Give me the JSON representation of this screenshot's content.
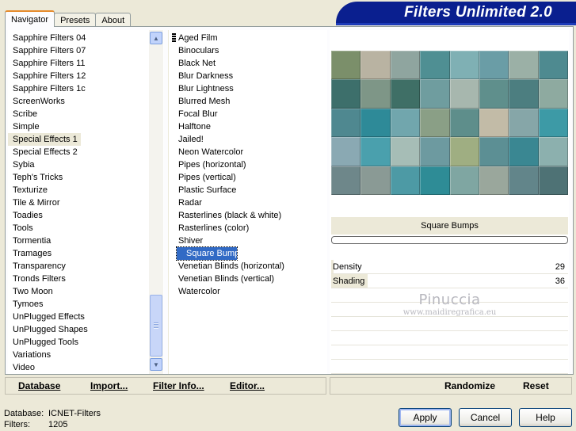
{
  "brand": {
    "title": "Filters Unlimited 2.0"
  },
  "tabs": [
    {
      "label": "Navigator",
      "active": true
    },
    {
      "label": "Presets",
      "active": false
    },
    {
      "label": "About",
      "active": false
    }
  ],
  "categories": [
    "Sapphire Filters 04",
    "Sapphire Filters 07",
    "Sapphire Filters 11",
    "Sapphire Filters 12",
    "Sapphire Filters 1c",
    "ScreenWorks",
    "Scribe",
    "Simple",
    "Special Effects 1",
    "Special Effects 2",
    "Sybia",
    "Teph's Tricks",
    "Texturize",
    "Tile & Mirror",
    "Toadies",
    "Tools",
    "Tormentia",
    "Tramages",
    "Transparency",
    "Tronds Filters",
    "Two Moon",
    "Tymoes",
    "UnPlugged Effects",
    "UnPlugged Shapes",
    "UnPlugged Tools",
    "Variations",
    "Video"
  ],
  "selected_category": "Special Effects 1",
  "filters": [
    "Aged Film",
    "Binoculars",
    "Black Net",
    "Blur Darkness",
    "Blur Lightness",
    "Blurred Mesh",
    "Focal Blur",
    "Halftone",
    "Jailed!",
    "Neon Watercolor",
    "Pipes (horizontal)",
    "Pipes (vertical)",
    "Plastic Surface",
    "Radar",
    "Rasterlines (black & white)",
    "Rasterlines (color)",
    "Shiver",
    "Square Bumps",
    "Venetian Blinds (horizontal)",
    "Venetian Blinds (vertical)",
    "Watercolor"
  ],
  "selected_filter": "Square Bumps",
  "preview": {
    "filter_name": "Square Bumps",
    "tile_colors": [
      "#7b8f6a",
      "#b9b3a2",
      "#8fa59f",
      "#4f8f93",
      "#7fb0b4",
      "#6a9da6",
      "#9bb0a6",
      "#4e8a90",
      "#3d6f6b",
      "#7e9687",
      "#3f6f66",
      "#6f9d9f",
      "#a7b7ae",
      "#5f8f8c",
      "#4c7e80",
      "#8eaaa0",
      "#4f8890",
      "#2e8a98",
      "#71a6ad",
      "#8a9f86",
      "#5e8e8b",
      "#c2bba7",
      "#86a6a8",
      "#3d9aa6",
      "#8aa9b3",
      "#4aa0ad",
      "#a6bdb6",
      "#6d9aa0",
      "#9fae82",
      "#5c8f94",
      "#3a8792",
      "#8cb0ae",
      "#6e878a",
      "#8a9a95",
      "#4d9aa5",
      "#2e8c96",
      "#7fa6a2",
      "#9aa79c",
      "#62858a",
      "#4e7275"
    ]
  },
  "parameters": [
    {
      "label": "Density",
      "value": "29"
    },
    {
      "label": "Shading",
      "value": "36"
    }
  ],
  "watermark": {
    "line1": "Pinuccia",
    "line2": "www.maidiregrafica.eu"
  },
  "left_buttons": {
    "database": "Database",
    "import": "Import...",
    "filter_info": "Filter Info...",
    "editor": "Editor..."
  },
  "right_buttons": {
    "randomize": "Randomize",
    "reset": "Reset"
  },
  "status": {
    "database_label": "Database:",
    "database_value": "ICNET-Filters",
    "filters_label": "Filters:",
    "filters_value": "1205"
  },
  "dialog_buttons": {
    "apply": "Apply",
    "cancel": "Cancel",
    "help": "Help"
  },
  "colors": {
    "brand": "#0a1f8f",
    "selection": "#316ac5",
    "window": "#ece9d8"
  }
}
